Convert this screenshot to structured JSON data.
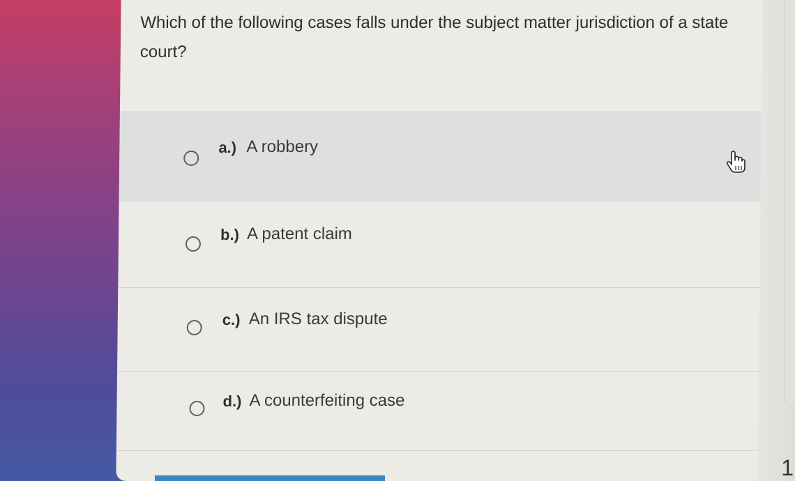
{
  "question": {
    "text": "Which of the following cases falls under the subject matter jurisdiction of a state court?"
  },
  "options": [
    {
      "letter": "a.)",
      "text": "A robbery"
    },
    {
      "letter": "b.)",
      "text": "A patent claim"
    },
    {
      "letter": "c.)",
      "text": "An IRS tax dispute"
    },
    {
      "letter": "d.)",
      "text": "A counterfeiting case"
    }
  ],
  "pagination": {
    "current": "1"
  },
  "cursor": {
    "icon": "hand-pointer-icon"
  },
  "colors": {
    "panel": "#ecebe6",
    "hover": "#dde0df",
    "submit_bar": "#3d86c6"
  }
}
